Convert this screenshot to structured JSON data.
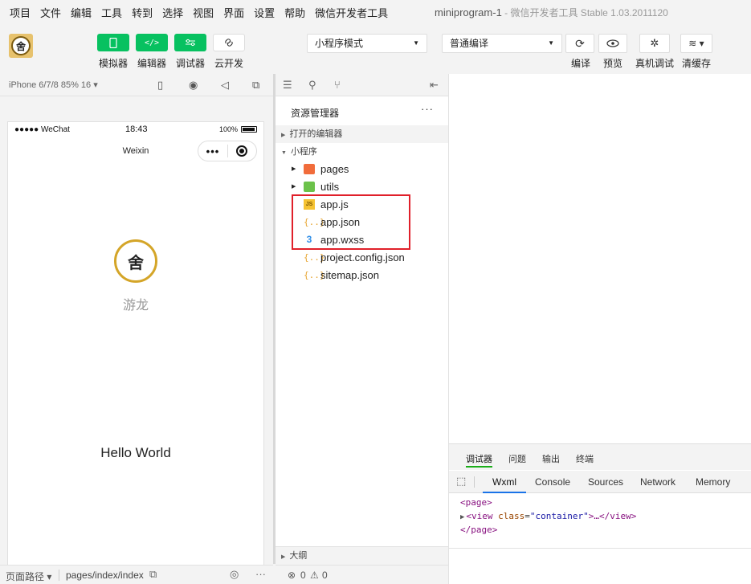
{
  "menu": {
    "items": [
      "项目",
      "文件",
      "编辑",
      "工具",
      "转到",
      "选择",
      "视图",
      "界面",
      "设置",
      "帮助",
      "微信开发者工具"
    ],
    "window_title": "miniprogram-1",
    "window_subtitle": " - 微信开发者工具 Stable 1.03.2011120"
  },
  "toolbar": {
    "simulator_label": "模拟器",
    "editor_label": "编辑器",
    "debugger_label": "调试器",
    "cloud_label": "云开发",
    "mode_select": "小程序模式",
    "compile_select": "普通编译",
    "compile_label": "编译",
    "preview_label": "预览",
    "realdevice_label": "真机调试",
    "clearcache_label": "清缓存"
  },
  "simulator": {
    "device": "iPhone 6/7/8 85% 16 ▾",
    "status_left": "●●●●● WeChat",
    "status_time": "18:43",
    "status_battery": "100%",
    "nav_title": "Weixin",
    "nickname": "游龙",
    "hello": "Hello World",
    "footer_path_label": "页面路径 ▾",
    "footer_path": "pages/index/index"
  },
  "explorer": {
    "title": "资源管理器",
    "more": "···",
    "open_editors": "打开的编辑器",
    "project": "小程序",
    "files": [
      {
        "name": "pages",
        "type": "folder"
      },
      {
        "name": "utils",
        "type": "folder"
      },
      {
        "name": "app.js",
        "type": "js"
      },
      {
        "name": "app.json",
        "type": "json"
      },
      {
        "name": "app.wxss",
        "type": "wxss"
      },
      {
        "name": "project.config.json",
        "type": "json"
      },
      {
        "name": "sitemap.json",
        "type": "json"
      }
    ],
    "outline": "大纲",
    "errors": "0",
    "warnings": "0"
  },
  "debugger": {
    "tabs": [
      "调试器",
      "问题",
      "输出",
      "终端"
    ],
    "devtools_tabs": [
      "Wxml",
      "Console",
      "Sources",
      "Network",
      "Memory"
    ],
    "code": {
      "line1": "<page>",
      "line2_tag": "<view ",
      "line2_attr": "class",
      "line2_eq": "=",
      "line2_val": "\"container\"",
      "line2_end": ">…</view>",
      "line3": "</page>"
    }
  }
}
